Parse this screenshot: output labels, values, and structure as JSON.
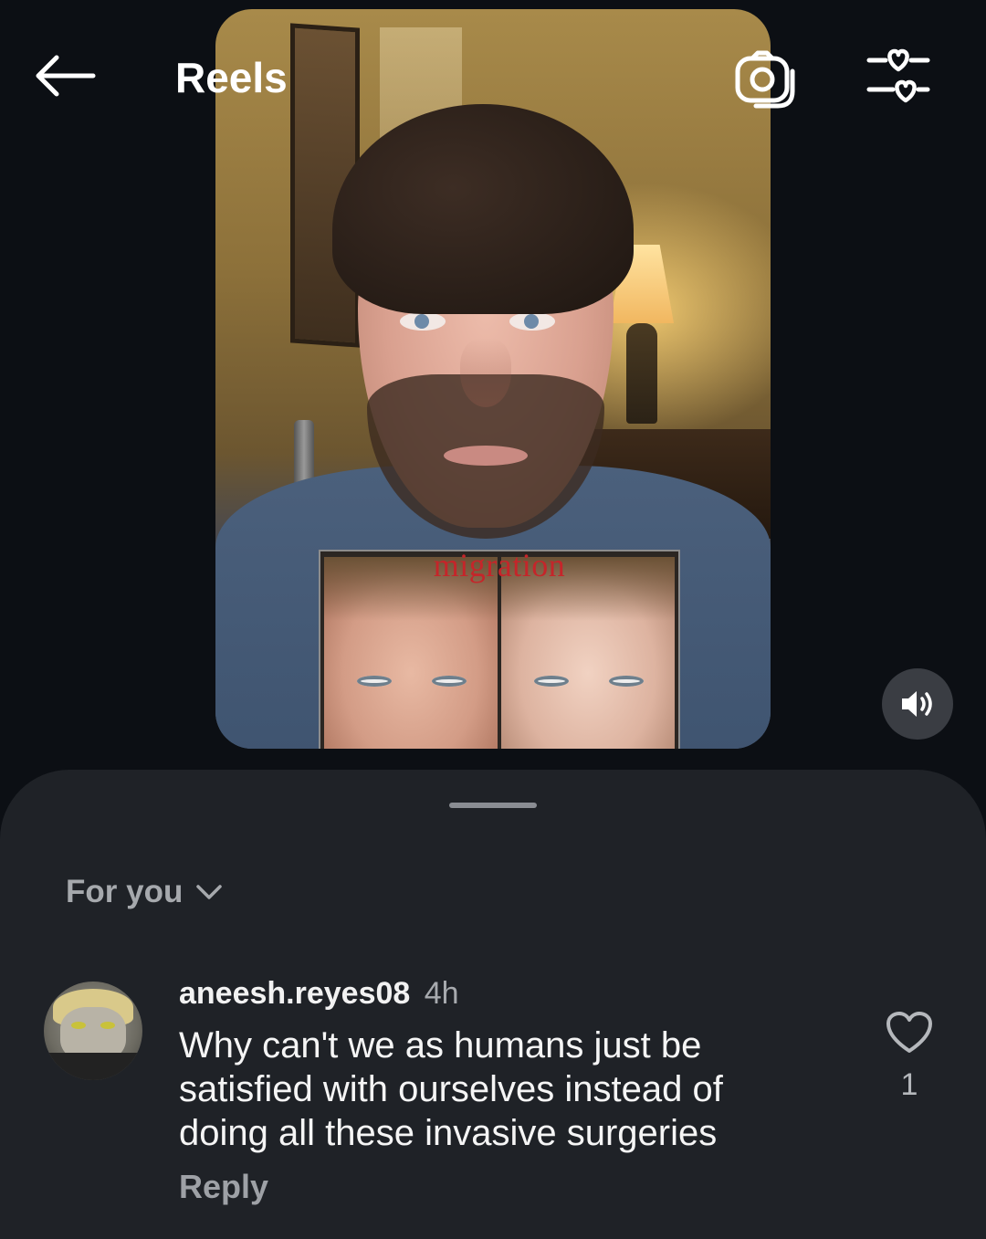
{
  "header": {
    "title": "Reels",
    "icons": [
      "back-arrow-icon",
      "camera-icon",
      "preferences-hearts-icon"
    ]
  },
  "video": {
    "overlay_caption": "migration",
    "sound_icon": "speaker-on-icon"
  },
  "comments_sheet": {
    "sort_label": "For you",
    "comments": [
      {
        "username": "aneesh.reyes08",
        "time": "4h",
        "text": "Why can't we as humans just be satisfied with ourselves instead of doing all these invasive surgeries",
        "reply_label": "Reply",
        "like_count": "1"
      }
    ]
  },
  "colors": {
    "background": "#0c0f14",
    "sheet": "#1f2227",
    "caption_red": "#c5252a"
  }
}
